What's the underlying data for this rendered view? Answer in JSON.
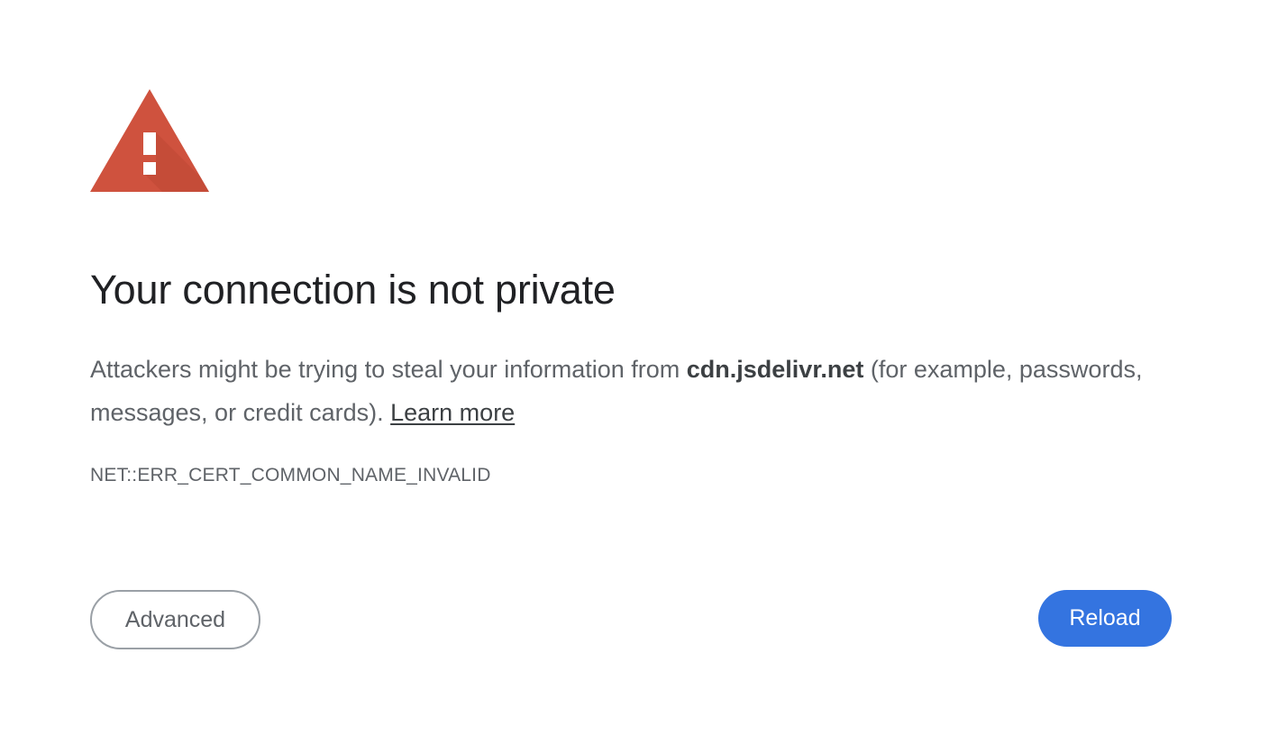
{
  "icon": "warning-triangle-icon",
  "colors": {
    "warning_red": "#cf523e",
    "title_text": "#202124",
    "body_text": "#5f6368",
    "primary_button": "#3474e0"
  },
  "title": "Your connection is not private",
  "explanation": {
    "prefix": "Attackers might be trying to steal your information from ",
    "domain": "cdn.jsdelivr.net",
    "suffix": " (for example, passwords, messages, or credit cards). ",
    "learn_more": "Learn more"
  },
  "error_code": "NET::ERR_CERT_COMMON_NAME_INVALID",
  "buttons": {
    "advanced": "Advanced",
    "reload": "Reload"
  }
}
